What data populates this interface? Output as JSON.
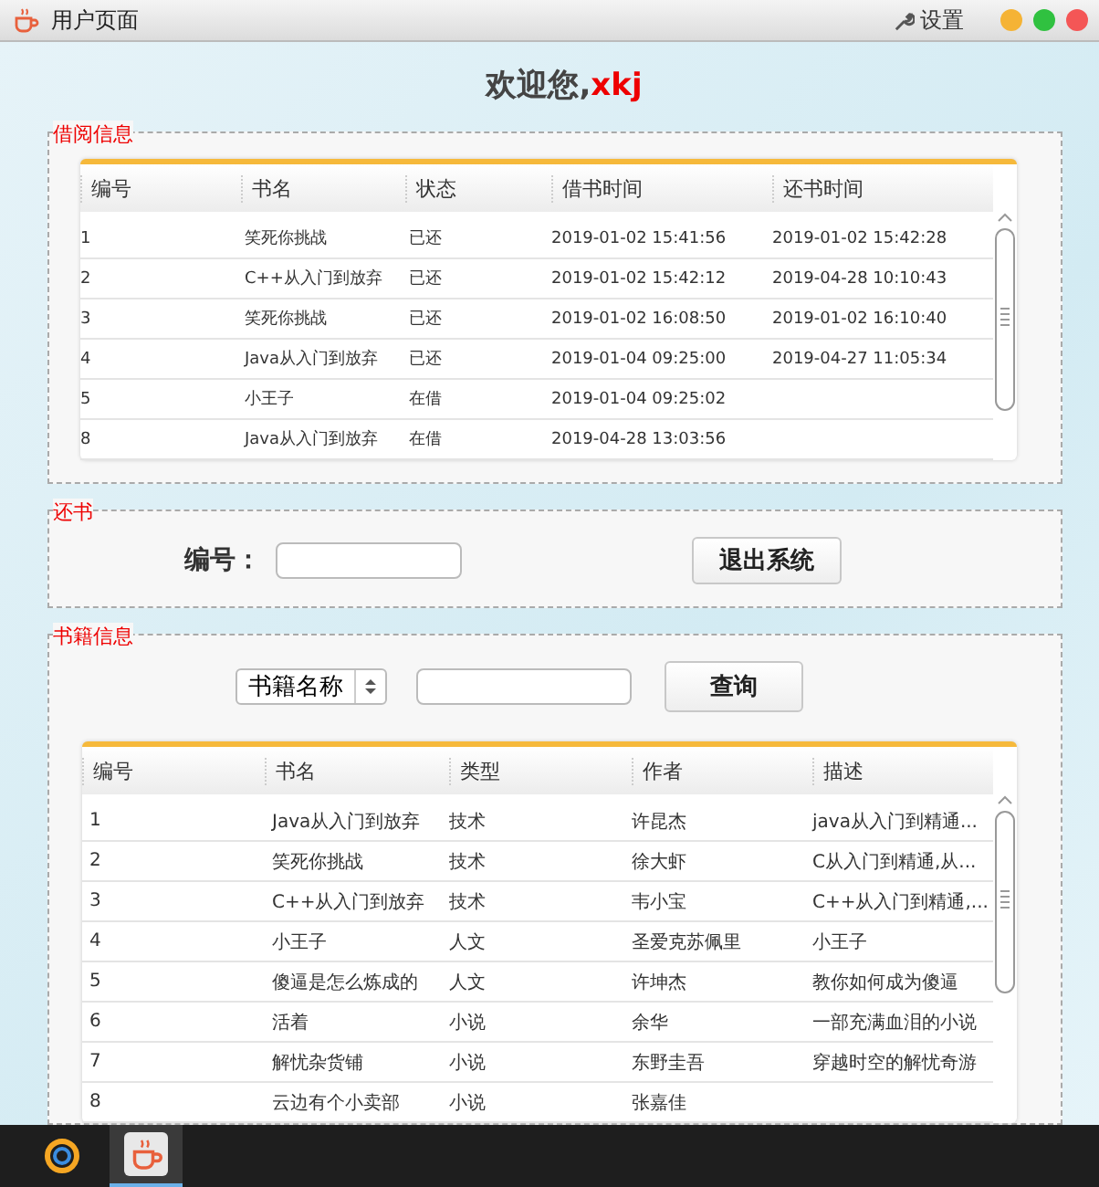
{
  "window": {
    "title": "用户页面",
    "settings_label": "设置"
  },
  "welcome": {
    "greeting": "欢迎您,",
    "user": "xkj"
  },
  "borrow_panel": {
    "title": "借阅信息",
    "columns": [
      "编号",
      "书名",
      "状态",
      "借书时间",
      "还书时间"
    ],
    "rows": [
      [
        "1",
        "笑死你挑战",
        "已还",
        "2019-01-02 15:41:56",
        "2019-01-02 15:42:28"
      ],
      [
        "2",
        "C++从入门到放弃",
        "已还",
        "2019-01-02 15:42:12",
        "2019-04-28 10:10:43"
      ],
      [
        "3",
        "笑死你挑战",
        "已还",
        "2019-01-02 16:08:50",
        "2019-01-02 16:10:40"
      ],
      [
        "4",
        "Java从入门到放弃",
        "已还",
        "2019-01-04 09:25:00",
        "2019-04-27 11:05:34"
      ],
      [
        "5",
        "小王子",
        "在借",
        "2019-01-04 09:25:02",
        ""
      ],
      [
        "8",
        "Java从入门到放弃",
        "在借",
        "2019-04-28 13:03:56",
        ""
      ]
    ]
  },
  "return_panel": {
    "title": "还书",
    "id_label": "编号：",
    "exit_button": "退出系统"
  },
  "books_panel": {
    "title": "书籍信息",
    "search_select": "书籍名称",
    "query_button": "查询",
    "columns": [
      "编号",
      "书名",
      "类型",
      "作者",
      "描述"
    ],
    "rows": [
      [
        "1",
        "Java从入门到放弃",
        "技术",
        "许昆杰",
        "java从入门到精通..."
      ],
      [
        "2",
        "笑死你挑战",
        "技术",
        "徐大虾",
        "C从入门到精通,从..."
      ],
      [
        "3",
        "C++从入门到放弃",
        "技术",
        "韦小宝",
        "C++从入门到精通,..."
      ],
      [
        "4",
        "小王子",
        "人文",
        "圣爱克苏佩里",
        "小王子"
      ],
      [
        "5",
        "傻逼是怎么炼成的",
        "人文",
        "许坤杰",
        "教你如何成为傻逼"
      ],
      [
        "6",
        "活着",
        "小说",
        "余华",
        "一部充满血泪的小说"
      ],
      [
        "7",
        "解忧杂货铺",
        "小说",
        "东野圭吾",
        "穿越时空的解忧奇游"
      ],
      [
        "8",
        "云边有个小卖部",
        "小说",
        "张嘉佳",
        ""
      ]
    ]
  },
  "taskbar": [
    {
      "kind": "launcher",
      "selected": false
    },
    {
      "kind": "java",
      "selected": true
    }
  ]
}
